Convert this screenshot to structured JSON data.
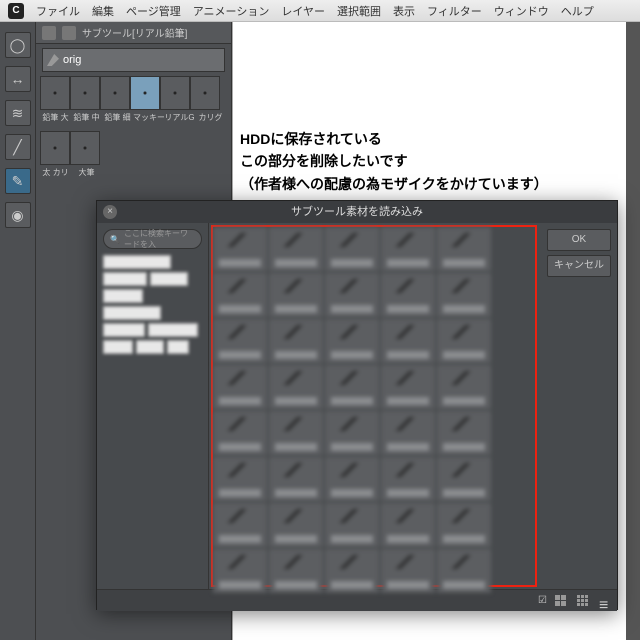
{
  "menubar": {
    "items": [
      "ファイル",
      "編集",
      "ページ管理",
      "アニメーション",
      "レイヤー",
      "選択範囲",
      "表示",
      "フィルター",
      "ウィンドウ",
      "ヘルプ"
    ]
  },
  "subtool_panel": {
    "title": "サブツール[リアル鉛筆]",
    "current": "orig",
    "cells": [
      "鉛筆 大",
      "鉛筆 中",
      "鉛筆 細",
      "マッキー",
      "リアルG",
      "カリグ"
    ],
    "cells2": [
      "太 カリ",
      "大筆"
    ]
  },
  "annotation": {
    "line1": "HDDに保存されている",
    "line2": "この部分を削除したいです",
    "line3": "（作者様への配慮の為モザイクをかけています）"
  },
  "dialog": {
    "title": "サブツール素材を読み込み",
    "search_placeholder": "ここに検索キーワードを入",
    "ok": "OK",
    "cancel": "キャンセル"
  }
}
